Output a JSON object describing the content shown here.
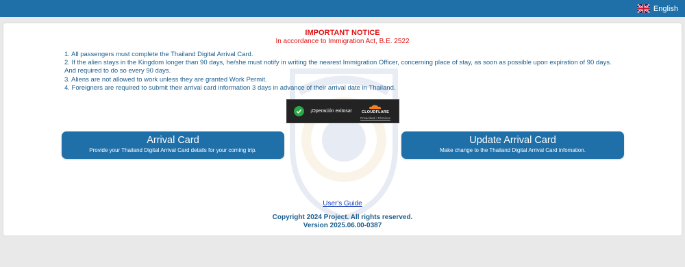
{
  "header": {
    "language_label": "English",
    "color": "#1f6fa8"
  },
  "notice": {
    "title": "IMPORTANT NOTICE",
    "subtitle": "In accordance to Immigration Act, B.E. 2522",
    "rules": [
      "1. All passengers must complete the Thailand Digital Arrival Card.",
      "2. If the alien stays in the Kingdom longer than 90 days, he/she must notify in writing the nearest Immigration Officer, concerning place of stay, as soon as possible upon expiration of 90 days. And required to do so every 90 days.",
      "3. Aliens are not allowed to work unless they are granted Work Permit.",
      "4. Foreigners are required to submit their arrival card information 3 days in advance of their arrival date in Thailand."
    ]
  },
  "captcha": {
    "status_text": "¡Operación exitosa!",
    "brand": "CLOUDFLARE",
    "links": "Privacidad • Términos"
  },
  "actions": {
    "arrival": {
      "title": "Arrival Card",
      "description": "Provide your Thailand Digital Arrival Card details for your coming trip."
    },
    "update": {
      "title": "Update Arrival Card",
      "description": "Make change to the Thailand Digital Arrival Card infomation."
    }
  },
  "footer": {
    "guide_link": "User's Guide",
    "copyright": "Copyright 2024 Project. All rights reserved.",
    "version": "Version 2025.06.00-0387"
  },
  "icons": {
    "language": "uk-flag-icon",
    "captcha_check": "check-circle-icon",
    "captcha_brand": "cloudflare-cloud-icon",
    "watermark": "immigration-bureau-emblem"
  }
}
